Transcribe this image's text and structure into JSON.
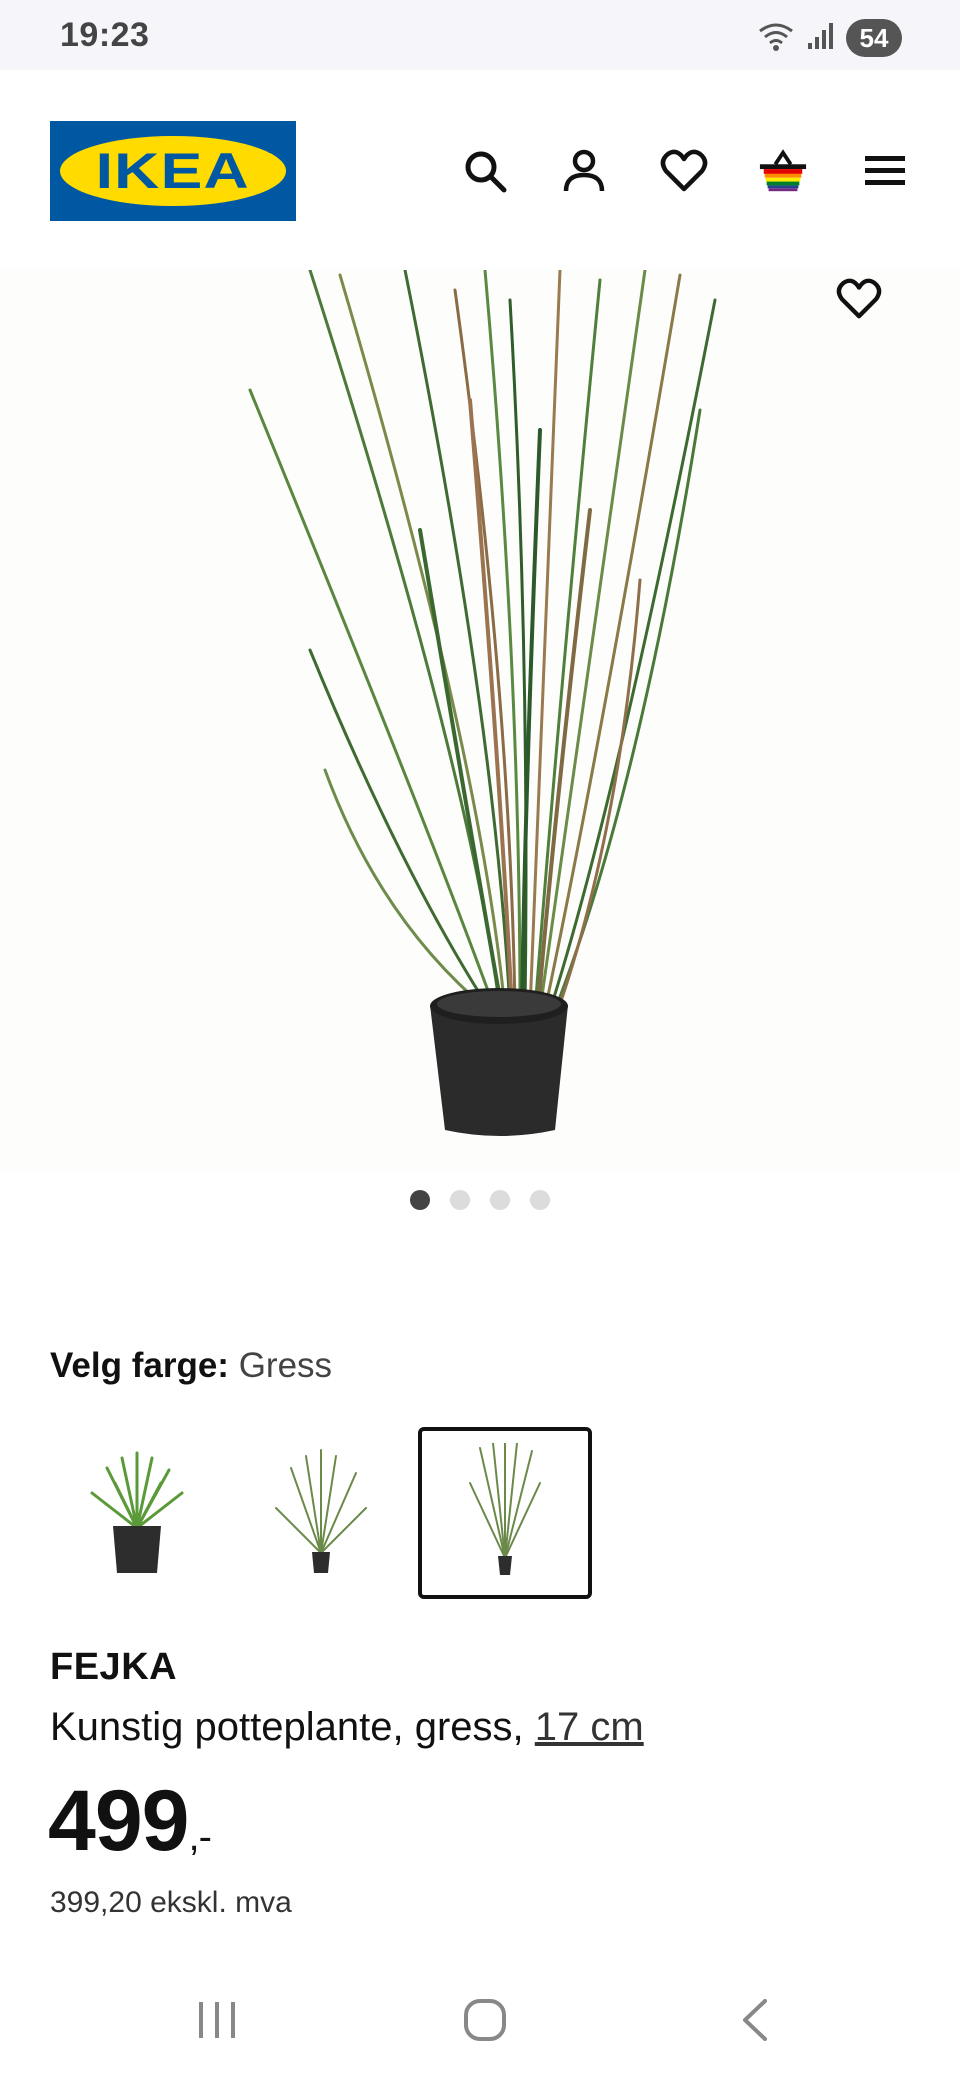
{
  "status_bar": {
    "time": "19:23",
    "battery": "54",
    "icons": [
      "wifi-icon",
      "signal-icon",
      "battery-icon"
    ]
  },
  "header": {
    "logo_text": "IKEA",
    "icons": [
      "search-icon",
      "account-icon",
      "heart-icon",
      "basket-icon",
      "menu-icon"
    ]
  },
  "gallery": {
    "image_count": 4,
    "active_index": 0,
    "favorite_icon": "heart-icon"
  },
  "color": {
    "label": "Velg farge:",
    "value": "Gress",
    "swatches_selected_index": 2
  },
  "product": {
    "name": "FEJKA",
    "description": "Kunstig potteplante, gress,",
    "size_link": "17 cm",
    "price": "499",
    "price_suffix": ",-",
    "price_ex_vat": "399,20 ekskl. mva"
  },
  "colors": {
    "ikea_blue": "#0058a3",
    "ikea_yellow": "#ffdb00",
    "text": "#111111"
  },
  "navbar": {
    "icons": [
      "recent-apps-icon",
      "home-icon",
      "back-icon"
    ]
  }
}
